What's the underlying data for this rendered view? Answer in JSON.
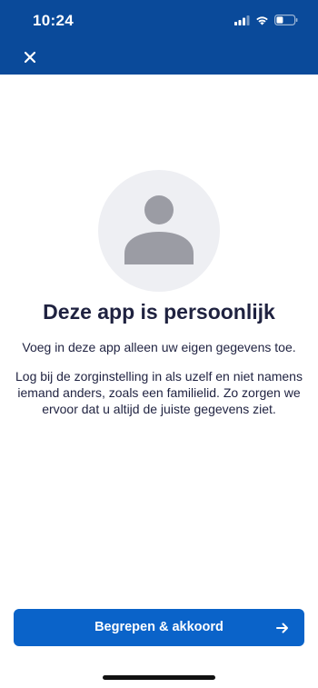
{
  "status_bar": {
    "time": "10:24",
    "icons": [
      "signal-icon",
      "wifi-icon",
      "battery-icon"
    ]
  },
  "nav": {
    "close_icon": "close-icon"
  },
  "colors": {
    "header": "#0a4a9a",
    "button": "#0a63c9",
    "text": "#1f2240",
    "avatar_bg": "#eeeff3",
    "avatar_fg": "#9b9ca4"
  },
  "content": {
    "avatar_icon": "user-avatar-icon",
    "title": "Deze app is persoonlijk",
    "intro": "Voeg in deze app alleen uw eigen gegevens toe.",
    "body": "Log bij de zorginstelling in als uzelf en niet namens iemand anders, zoals een familielid. Zo zorgen we ervoor dat u altijd de juiste gegevens ziet."
  },
  "actions": {
    "confirm_label": "Begrepen & akkoord",
    "confirm_icon": "arrow-right-icon"
  }
}
